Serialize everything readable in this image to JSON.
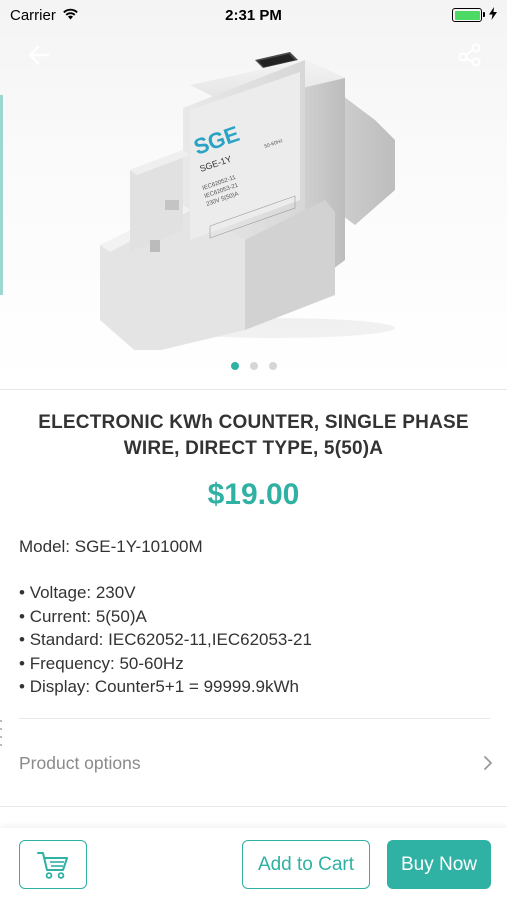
{
  "status_bar": {
    "carrier": "Carrier",
    "time": "2:31 PM",
    "battery_level": 1.0,
    "icons": [
      "wifi-icon",
      "battery-icon",
      "charging-bolt-icon"
    ]
  },
  "header": {
    "back_icon": "back-arrow-icon",
    "share_icon": "share-icon"
  },
  "gallery": {
    "image_count": 3,
    "active_index": 0,
    "device_label": {
      "brand": "SGE",
      "model": "SGE-1Y",
      "lines": [
        "IEC62052-11",
        "IEC62053-21",
        "230V   5(50)A",
        "50-60Hz"
      ]
    }
  },
  "product": {
    "title": "ELECTRONIC KWh COUNTER, SINGLE PHASE WIRE, DIRECT TYPE, 5(50)A",
    "price": "$19.00",
    "model": "Model: SGE-1Y-10100M",
    "specs": [
      "Voltage: 230V",
      "Current: 5(50)A",
      "Standard: IEC62052-11,IEC62053-21",
      "Frequency: 50-60Hz",
      "Display: Counter5+1 = 99999.9kWh"
    ]
  },
  "options": {
    "label": "Product options",
    "icon": "chevron-right-icon"
  },
  "bottom_bar": {
    "cart_icon": "cart-icon",
    "add_to_cart_label": "Add to Cart",
    "buy_now_label": "Buy Now"
  },
  "colors": {
    "accent": "#2fb1a3",
    "text": "#333333",
    "muted": "#8a8a8a"
  }
}
